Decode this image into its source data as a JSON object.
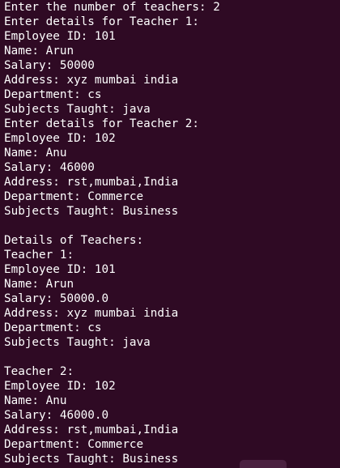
{
  "terminal": {
    "lines": [
      "Enter the number of teachers: 2",
      "Enter details for Teacher 1:",
      "Employee ID: 101",
      "Name: Arun",
      "Salary: 50000",
      "Address: xyz mumbai india",
      "Department: cs",
      "Subjects Taught: java",
      "Enter details for Teacher 2:",
      "Employee ID: 102",
      "Name: Anu",
      "Salary: 46000",
      "Address: rst,mumbai,India",
      "Department: Commerce",
      "Subjects Taught: Business",
      "",
      "Details of Teachers:",
      "Teacher 1:",
      "Employee ID: 101",
      "Name: Arun",
      "Salary: 50000.0",
      "Address: xyz mumbai india",
      "Department: cs",
      "Subjects Taught: java",
      "",
      "Teacher 2:",
      "Employee ID: 102",
      "Name: Anu",
      "Salary: 46000.0",
      "Address: rst,mumbai,India",
      "Department: Commerce",
      "Subjects Taught: Business"
    ]
  },
  "colors": {
    "background": "#2f0a24",
    "text": "#ffffff"
  }
}
